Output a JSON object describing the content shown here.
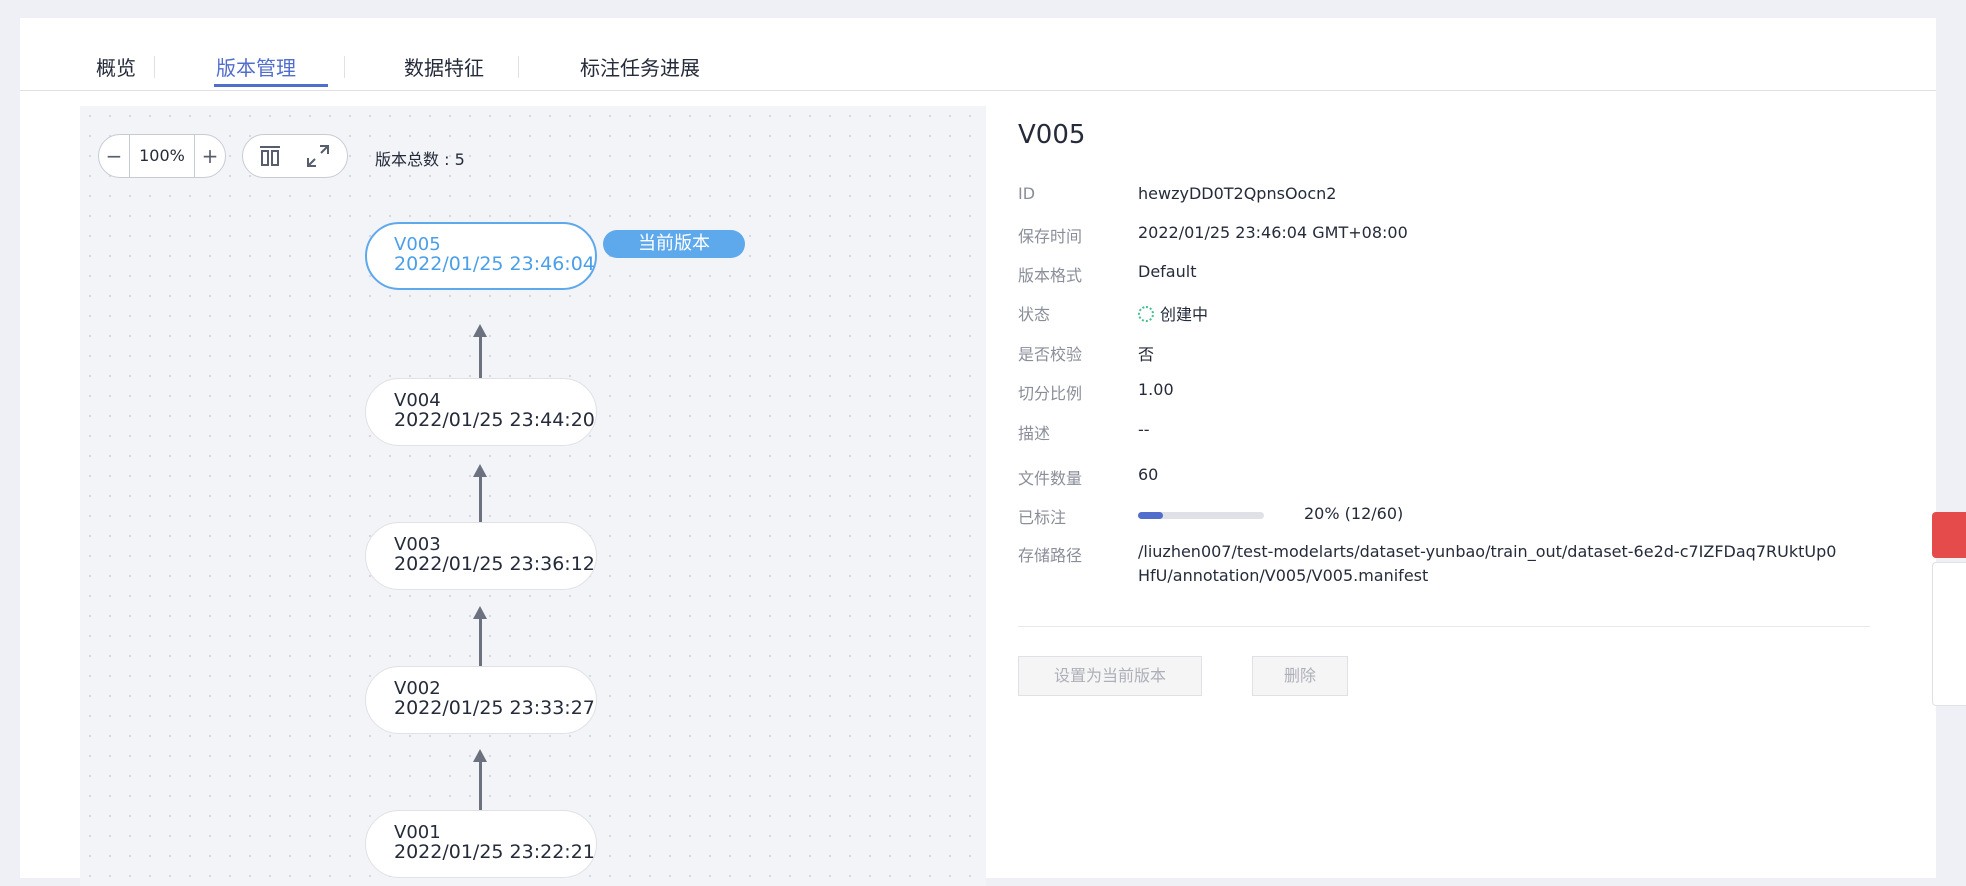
{
  "tabs": [
    {
      "label": "概览"
    },
    {
      "label": "版本管理"
    },
    {
      "label": "数据特征"
    },
    {
      "label": "标注任务进展"
    }
  ],
  "toolbar": {
    "zoom_minus": "−",
    "zoom_value": "100%",
    "zoom_plus": "+",
    "total_versions": "版本总数 : 5"
  },
  "current_badge": "当前版本",
  "versions": [
    {
      "name": "V005",
      "time": "2022/01/25 23:46:04"
    },
    {
      "name": "V004",
      "time": "2022/01/25 23:44:20"
    },
    {
      "name": "V003",
      "time": "2022/01/25 23:36:12"
    },
    {
      "name": "V002",
      "time": "2022/01/25 23:33:27"
    },
    {
      "name": "V001",
      "time": "2022/01/25 23:22:21"
    }
  ],
  "detail": {
    "title": "V005",
    "rows": {
      "id": {
        "label": "ID",
        "value": "hewzyDD0T2QpnsOocn2"
      },
      "saved": {
        "label": "保存时间",
        "value": "2022/01/25 23:46:04 GMT+08:00"
      },
      "format": {
        "label": "版本格式",
        "value": "Default"
      },
      "status": {
        "label": "状态",
        "value": "创建中"
      },
      "verified": {
        "label": "是否校验",
        "value": "否"
      },
      "split": {
        "label": "切分比例",
        "value": "1.00"
      },
      "desc": {
        "label": "描述",
        "value": "--"
      },
      "files": {
        "label": "文件数量",
        "value": "60"
      },
      "labeled": {
        "label": "已标注",
        "value": "20% (12/60)",
        "progress": 0.2
      },
      "path": {
        "label": "存储路径",
        "value": "/liuzhen007/test-modelarts/dataset-yunbao/train_out/dataset-6e2d-c7IZFDaq7RUktUp0HfU/annotation/V005/V005.manifest"
      }
    }
  },
  "buttons": {
    "set_current": "设置为当前版本",
    "delete": "删除"
  },
  "colors": {
    "accent": "#526ecc",
    "current_node": "#5ea8ec",
    "status_spinner": "#43c089"
  }
}
